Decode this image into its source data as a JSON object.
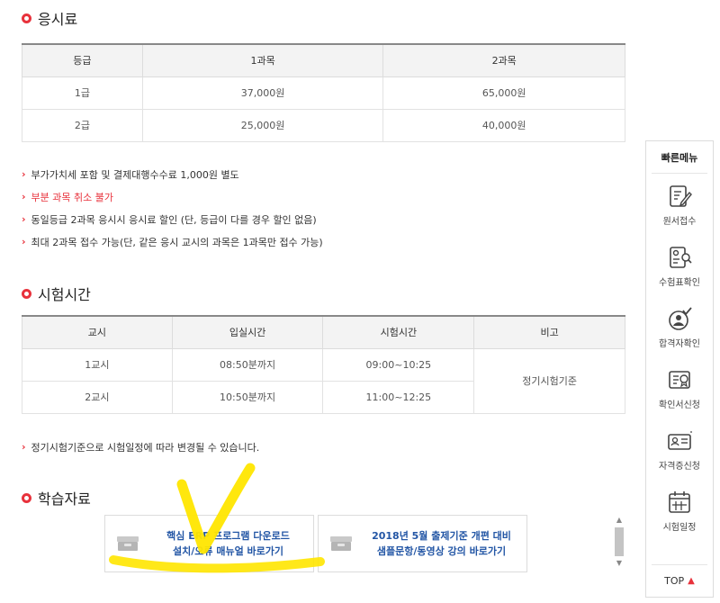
{
  "fee": {
    "title": "응시료",
    "headers": [
      "등급",
      "1과목",
      "2과목"
    ],
    "rows": [
      [
        "1급",
        "37,000원",
        "65,000원"
      ],
      [
        "2급",
        "25,000원",
        "40,000원"
      ]
    ],
    "notes": [
      "부가가치세 포함 및 결제대행수수료 1,000원 별도",
      "부분 과목 취소 불가",
      "동일등급 2과목 응시시 응시료 할인 (단, 등급이 다를 경우 할인 없음)",
      "최대 2과목 접수 가능(단, 같은 응시 교시의 과목은 1과목만 접수 가능)"
    ]
  },
  "time": {
    "title": "시험시간",
    "headers": [
      "교시",
      "입실시간",
      "시험시간",
      "비고"
    ],
    "rows": [
      [
        "1교시",
        "08:50분까지",
        "09:00~10:25"
      ],
      [
        "2교시",
        "10:50분까지",
        "11:00~12:25"
      ]
    ],
    "remark": "정기시험기준",
    "note": "정기시험기준으로 시험일정에 따라 변경될 수 있습니다."
  },
  "materials": {
    "title": "학습자료",
    "cards": [
      {
        "line1": "핵심 ERP 프로그램 다운로드",
        "line2": "설치/오류 매뉴얼 바로가기"
      },
      {
        "line1": "2018년 5월 출제기준 개편 대비",
        "line2": "샘플문항/동영상 강의 바로가기"
      }
    ]
  },
  "quick_menu": {
    "title": "빠른메뉴",
    "items": [
      {
        "label": "원서접수",
        "icon": "application-pen-icon"
      },
      {
        "label": "수험표확인",
        "icon": "admission-ticket-icon"
      },
      {
        "label": "합격자확인",
        "icon": "pass-check-icon"
      },
      {
        "label": "확인서신청",
        "icon": "certificate-request-icon"
      },
      {
        "label": "자격증신청",
        "icon": "license-card-icon"
      },
      {
        "label": "시험일정",
        "icon": "calendar-icon"
      }
    ],
    "top_label": "TOP"
  },
  "colors": {
    "accent": "#e8323c",
    "link": "#2356a5",
    "highlight": "#ffe600"
  }
}
